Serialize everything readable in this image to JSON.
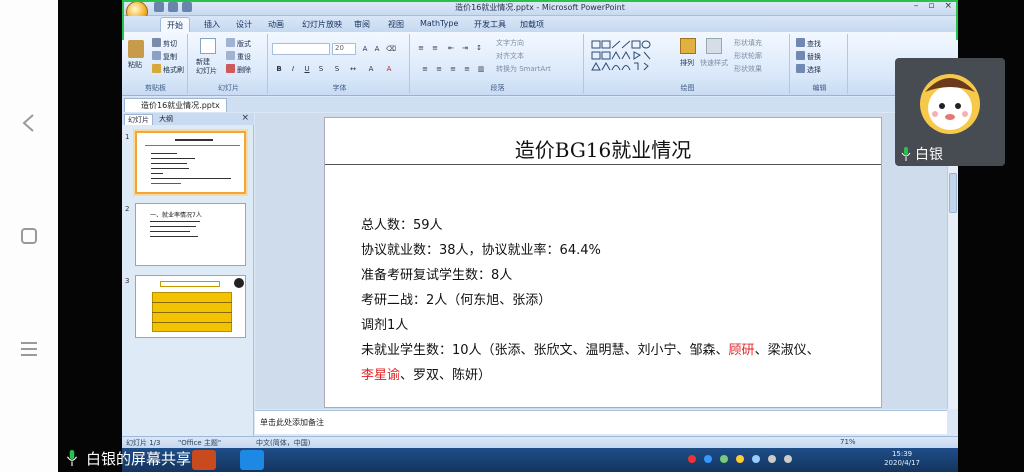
{
  "window": {
    "title": "造价16就业情况.pptx - Microsoft PowerPoint"
  },
  "tabs": [
    "开始",
    "插入",
    "设计",
    "动画",
    "幻灯片放映",
    "审阅",
    "视图",
    "MathType",
    "开发工具",
    "加载项"
  ],
  "ribbon": {
    "clipboard": {
      "paste": "粘贴",
      "cut": "剪切",
      "copy": "复制",
      "format_painter": "格式刷",
      "label": "剪贴板"
    },
    "slides": {
      "new_slide": "新建\n幻灯片",
      "layout": "版式",
      "reset": "重设",
      "delete": "删除",
      "label": "幻灯片"
    },
    "font": {
      "size": "20",
      "label": "字体"
    },
    "paragraph": {
      "text_direction": "文字方向",
      "align_text": "对齐文本",
      "smartart": "转换为 SmartArt",
      "label": "段落"
    },
    "drawing": {
      "arrange": "排列",
      "quick_styles": "快速样式",
      "shape_fill": "形状填充",
      "shape_outline": "形状轮廓",
      "shape_effects": "形状效果",
      "label": "绘图"
    },
    "editing": {
      "find": "查找",
      "replace": "替换",
      "select": "选择",
      "label": "编辑"
    }
  },
  "document_tab": "造价16就业情况.pptx",
  "panel": {
    "tab_slides": "幻灯片",
    "tab_outline": "大纲",
    "close": "×",
    "thumbs": [
      "1",
      "2",
      "3"
    ],
    "thumb2_title": "一、就业率情况7人"
  },
  "slide": {
    "title": "造价BG16就业情况",
    "lines": [
      "总人数：59人",
      "协议就业数：38人，协议就业率：64.4%",
      "准备考研复试学生数：8人",
      "考研二战：2人（何东旭、张添）",
      "调剂1人"
    ],
    "unemployed_prefix": "未就业学生数：10人（张添、张欣文、温明慧、刘小宁、邹森、",
    "unemployed_red1": "顾研",
    "unemployed_mid": "、梁淑仪、",
    "unemployed_red2": "李星谕",
    "unemployed_suffix": "、罗双、陈妍）"
  },
  "notes_placeholder": "单击此处添加备注",
  "status": {
    "slide_info": "幻灯片 1/3",
    "theme": "\"Office 主题\"",
    "language": "中文(简体，中国)",
    "zoom": "71%"
  },
  "clock": {
    "time": "15:39",
    "date": "2020/4/17"
  },
  "video": {
    "name": "白银"
  },
  "share_label": "白银的屏幕共享",
  "colors": {
    "accent_green": "#27c24c",
    "highlight_red": "#e02424",
    "taskbar": "#1f4e89"
  }
}
